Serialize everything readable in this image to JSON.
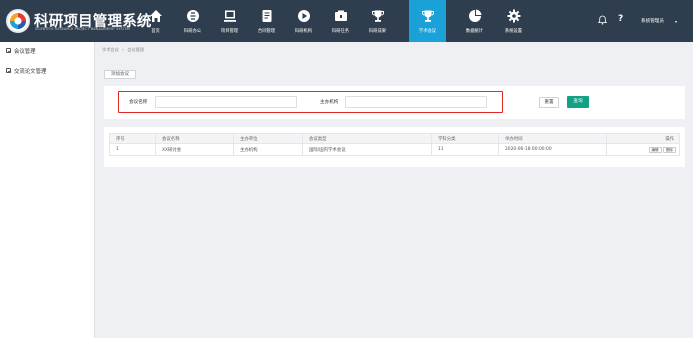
{
  "app": {
    "title": "科研项目管理系统",
    "subtitle": "SCIENTIFIC RESEARCH PROJECT MANAGEMENT SYSTEM"
  },
  "nav": [
    {
      "label": "首页",
      "icon": "home-icon"
    },
    {
      "label": "科研办公",
      "icon": "office-icon"
    },
    {
      "label": "项目管理",
      "icon": "project-icon"
    },
    {
      "label": "合同管理",
      "icon": "contract-icon"
    },
    {
      "label": "科研机构",
      "icon": "institution-icon"
    },
    {
      "label": "科研任务",
      "icon": "task-icon"
    },
    {
      "label": "科研成果",
      "icon": "trophy-icon"
    },
    {
      "label": "学术会议",
      "icon": "academic-trophy-icon"
    },
    {
      "label": "数据统计",
      "icon": "pie-chart-icon"
    },
    {
      "label": "系统设置",
      "icon": "gear-icon"
    }
  ],
  "active_nav": "学术会议",
  "header": {
    "help": "?",
    "user": "系统管理员",
    "caret": "▾"
  },
  "sidebar": {
    "items": [
      {
        "label": "会议管理"
      },
      {
        "label": "交流论文管理"
      }
    ]
  },
  "breadcrumb": {
    "parent": "学术会议",
    "sep": "»",
    "current": "会议管理"
  },
  "toolbar": {
    "add_label": "添加会议"
  },
  "search": {
    "field1_label": "会议名称",
    "field1_value": "",
    "field2_label": "主办机构",
    "field2_value": "",
    "reset_label": "重置",
    "query_label": "查询"
  },
  "table": {
    "columns": [
      "序号",
      "会议名称",
      "主办单位",
      "会议类型",
      "学科分类",
      "举办时间",
      "操作"
    ],
    "rows": [
      {
        "index": "1",
        "name": "XX研讨会",
        "host": "主办机构",
        "type": "国际/国内学术会议",
        "subject": "11",
        "time": "2020-06-18 00:00:00",
        "actions": [
          "编辑",
          "删除"
        ]
      }
    ]
  },
  "colors": {
    "topbar": "#2f3e4e",
    "active_tab": "#1aa2d8",
    "query_button": "#12a185",
    "highlight_border": "#e02a2a"
  }
}
